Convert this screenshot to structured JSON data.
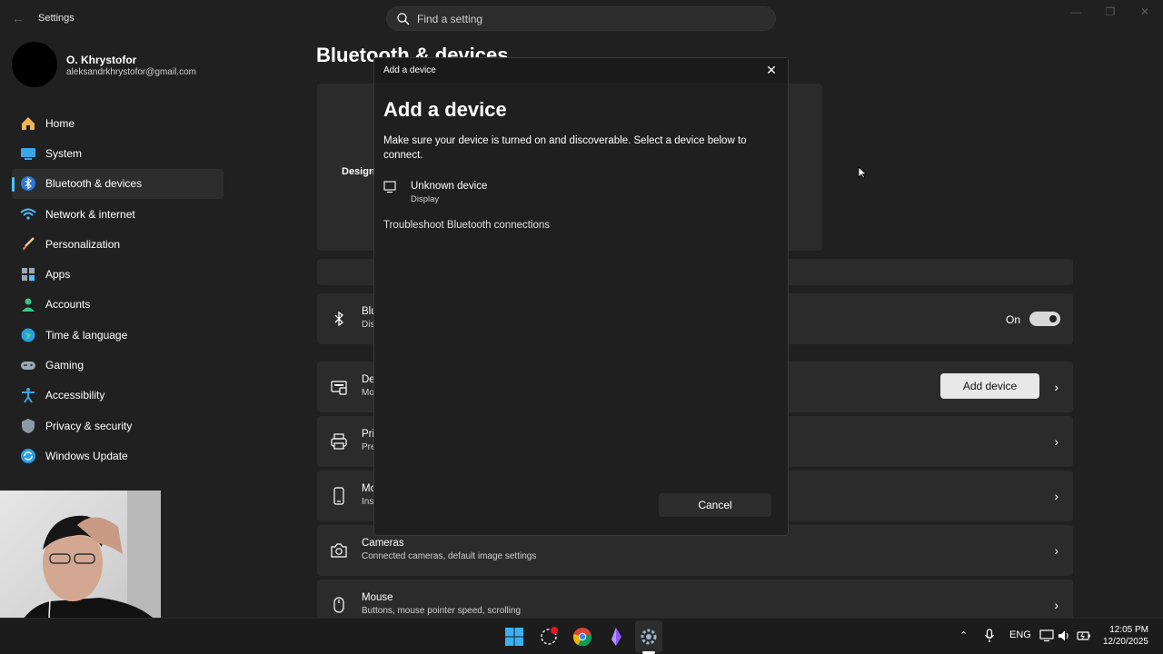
{
  "window": {
    "app_title": "Settings"
  },
  "search": {
    "placeholder": "Find a setting"
  },
  "profile": {
    "name": "O. Khrystofor",
    "email": "aleksandrkhrystofor@gmail.com"
  },
  "sidebar": {
    "items": [
      {
        "label": "Home",
        "icon": "home-icon"
      },
      {
        "label": "System",
        "icon": "system-icon"
      },
      {
        "label": "Bluetooth & devices",
        "icon": "bluetooth-icon",
        "active": true
      },
      {
        "label": "Network & internet",
        "icon": "wifi-icon"
      },
      {
        "label": "Personalization",
        "icon": "brush-icon"
      },
      {
        "label": "Apps",
        "icon": "apps-icon"
      },
      {
        "label": "Accounts",
        "icon": "accounts-icon"
      },
      {
        "label": "Time & language",
        "icon": "globe-icon"
      },
      {
        "label": "Gaming",
        "icon": "gamepad-icon"
      },
      {
        "label": "Accessibility",
        "icon": "accessibility-icon"
      },
      {
        "label": "Privacy & security",
        "icon": "shield-icon"
      },
      {
        "label": "Windows Update",
        "icon": "update-icon"
      }
    ]
  },
  "main": {
    "page_title": "Bluetooth & devices",
    "hero_label": "Design",
    "rows": {
      "bluetooth": {
        "title": "Blu",
        "sub": "Dis",
        "state_label": "On"
      },
      "devices": {
        "title": "De",
        "sub": "Mo",
        "button": "Add device"
      },
      "printers": {
        "title": "Pri",
        "sub": "Pre"
      },
      "mobile": {
        "title": "Mo",
        "sub": "Ins"
      },
      "cameras": {
        "title": "Cameras",
        "sub": "Connected cameras, default image settings"
      },
      "mouse": {
        "title": "Mouse",
        "sub": "Buttons, mouse pointer speed, scrolling"
      }
    }
  },
  "dialog": {
    "bar_title": "Add a device",
    "heading": "Add a device",
    "description": "Make sure your device is turned on and discoverable. Select a device below to connect.",
    "devices": [
      {
        "name": "Unknown device",
        "type": "Display"
      }
    ],
    "troubleshoot": "Troubleshoot Bluetooth connections",
    "cancel": "Cancel"
  },
  "taskbar": {
    "language": "ENG",
    "time": "12:05 PM",
    "date": "12/20/2025"
  },
  "colors": {
    "accent": "#4cc2ff",
    "background": "#202020",
    "card": "#2b2b2b"
  }
}
